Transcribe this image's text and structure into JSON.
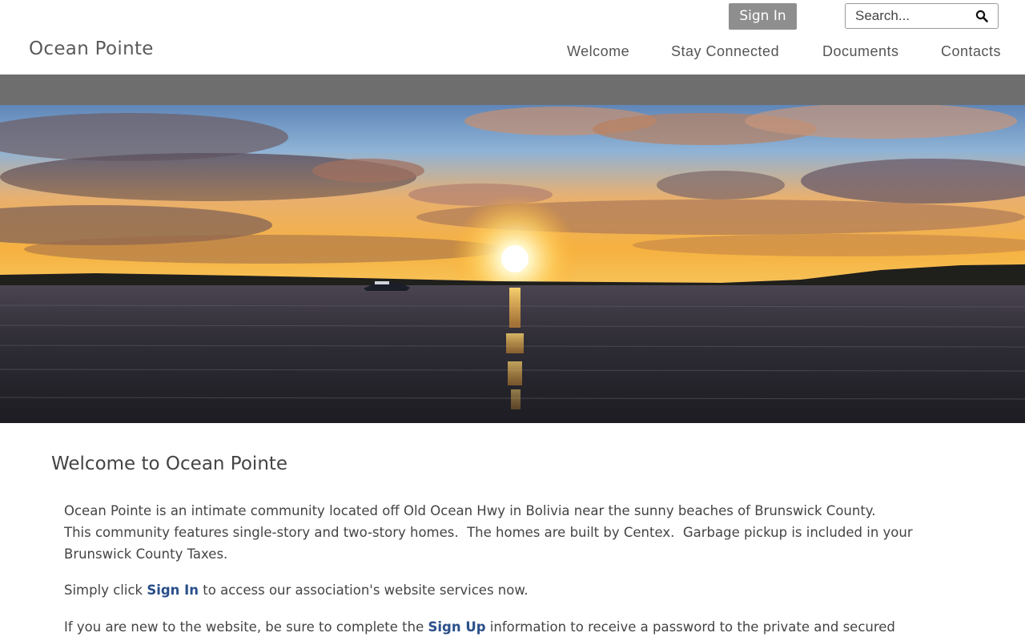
{
  "header": {
    "site_title": "Ocean Pointe",
    "signin_label": "Sign In",
    "search_placeholder": "Search...",
    "nav": [
      "Welcome",
      "Stay Connected",
      "Documents",
      "Contacts"
    ]
  },
  "hero": {
    "icon": "sunset-over-water-image"
  },
  "main": {
    "heading": "Welcome to Ocean Pointe",
    "p1_line1": "Ocean Pointe is an intimate community located off Old Ocean Hwy in Bolivia near the sunny beaches of Brunswick County.",
    "p1_line2": "This community features single-story and two-story homes.  The homes are built by Centex.  Garbage pickup is included in your",
    "p1_line3": "Brunswick County Taxes.",
    "p2_before": "Simply click ",
    "p2_link": "Sign In",
    "p2_after": " to access our association's website services now.",
    "p3_before": "If you are new to the website, be sure to complete the ",
    "p3_link": "Sign Up",
    "p3_after": " information to receive a password to the private and secured"
  },
  "colors": {
    "link": "#2a4f8a",
    "signin_bg": "#8e8e8e",
    "strip": "#6e6e6e"
  }
}
